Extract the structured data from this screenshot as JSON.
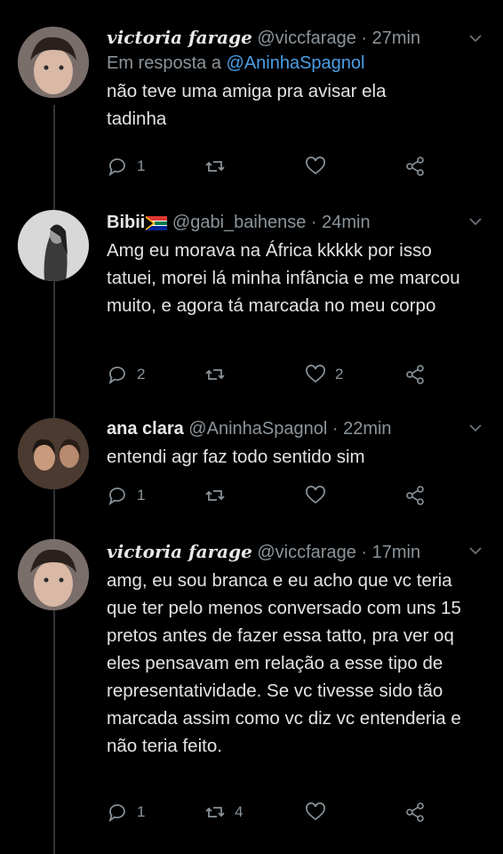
{
  "tweets": [
    {
      "name": "victoria farage",
      "handle": "@viccfarage",
      "time": "27min",
      "reply_label": "Em resposta a",
      "reply_mention": "@AninhaSpagnol",
      "text": "não teve uma amiga pra avisar ela tadinha",
      "replies": "1",
      "retweets": "",
      "likes": ""
    },
    {
      "name": "Bibii",
      "handle": "@gabi_baihense",
      "time": "24min",
      "text": "Amg eu morava na África kkkkk por isso tatuei, morei lá minha infância e me marcou muito, e agora tá marcada no meu corpo",
      "replies": "2",
      "retweets": "",
      "likes": "2"
    },
    {
      "name": "ana clara",
      "handle": "@AninhaSpagnol",
      "time": "22min",
      "text": "entendi agr faz todo sentido sim",
      "replies": "1",
      "retweets": "",
      "likes": ""
    },
    {
      "name": "victoria farage",
      "handle": "@viccfarage",
      "time": "17min",
      "text": "amg, eu sou branca e eu acho que vc teria que ter pelo menos conversado com uns 15 pretos antes de fazer essa tatto, pra ver oq eles pensavam em relação a esse tipo de representatividade. Se vc tivesse sido tão marcada assim como vc diz vc entenderia e não teria feito.",
      "replies": "1",
      "retweets": "4",
      "likes": ""
    }
  ],
  "separator": "·",
  "icons": [
    "reply-icon",
    "retweet-icon",
    "like-icon",
    "share-icon",
    "chevron-down-icon",
    "south-africa-flag-icon"
  ]
}
